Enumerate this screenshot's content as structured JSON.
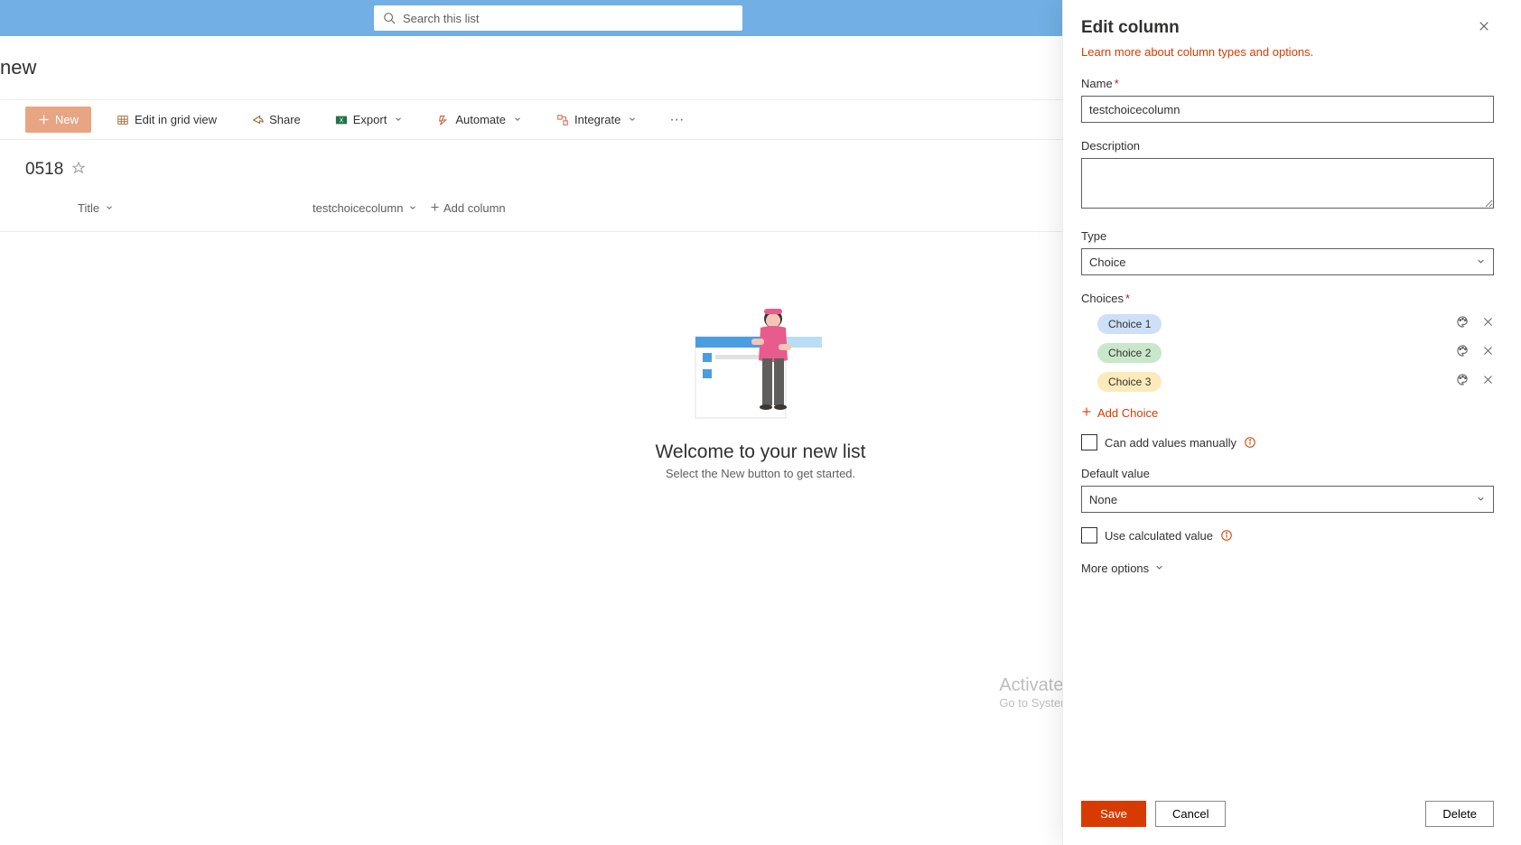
{
  "topbar": {
    "search_placeholder": "Search this list"
  },
  "site": {
    "title": "new"
  },
  "commands": {
    "new": "New",
    "edit_grid": "Edit in grid view",
    "share": "Share",
    "export": "Export",
    "automate": "Automate",
    "integrate": "Integrate"
  },
  "list": {
    "name": "0518",
    "columns": {
      "title": "Title",
      "choice_col": "testchoicecolumn",
      "add": "Add column"
    }
  },
  "empty": {
    "title": "Welcome to your new list",
    "subtitle": "Select the New button to get started."
  },
  "panel": {
    "title": "Edit column",
    "learn_link": "Learn more about column types and options.",
    "name_label": "Name",
    "name_value": "testchoicecolumn",
    "description_label": "Description",
    "description_value": "",
    "type_label": "Type",
    "type_value": "Choice",
    "choices_label": "Choices",
    "choices": [
      {
        "label": "Choice 1",
        "bg": "#cde0f6"
      },
      {
        "label": "Choice 2",
        "bg": "#c9e7c9"
      },
      {
        "label": "Choice 3",
        "bg": "#fdeabb"
      }
    ],
    "add_choice": "Add Choice",
    "can_add_manual": "Can add values manually",
    "default_value_label": "Default value",
    "default_value": "None",
    "use_calculated": "Use calculated value",
    "more_options": "More options",
    "save": "Save",
    "cancel": "Cancel",
    "delete": "Delete"
  },
  "watermark": {
    "title": "Activate Windows",
    "subtitle": "Go to System in Control Panel to activate Windows."
  }
}
